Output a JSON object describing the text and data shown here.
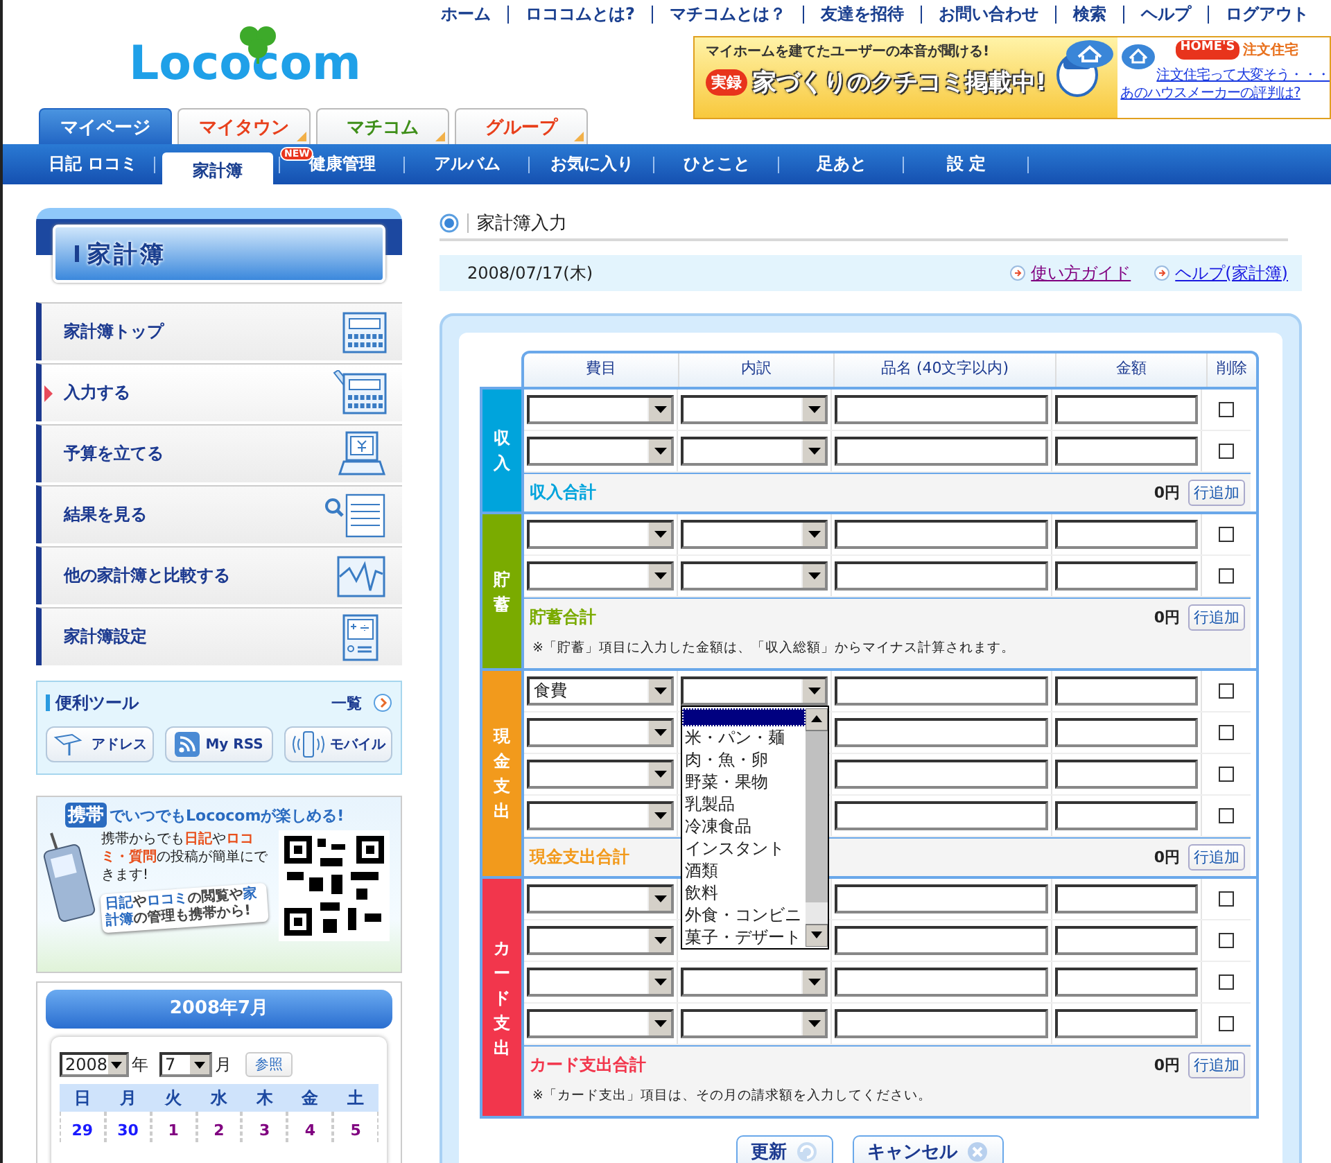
{
  "top_links": [
    "ホーム",
    "ロココムとは?",
    "マチコムとは？",
    "友達を招待",
    "お問い合わせ",
    "検索",
    "ヘルプ",
    "ログアウト"
  ],
  "logo": "Lococom",
  "ad_banner": {
    "tagline": "マイホームを建てたユーザーの本音が聞ける!",
    "badge": "実録",
    "headline": "家づくりのクチコミ掲載中!",
    "brand": "HOME'S",
    "brand_tag": "注文住宅",
    "links": [
      "注文住宅って大変そう・・・",
      "あのハウスメーカーの評判は?"
    ]
  },
  "main_tabs": [
    {
      "label": "マイページ",
      "selected": true
    },
    {
      "label": "マイタウン",
      "selected": false,
      "color": "#e8401c"
    },
    {
      "label": "マチコム",
      "selected": false,
      "color": "#3f8f1a"
    },
    {
      "label": "グループ",
      "selected": false,
      "color": "#e8401c"
    }
  ],
  "sub_nav": [
    {
      "label": "日記 ロコミ",
      "selected": false
    },
    {
      "label": "家計簿",
      "selected": true
    },
    {
      "label": "健康管理",
      "selected": false,
      "badge": "NEW"
    },
    {
      "label": "アルバム",
      "selected": false
    },
    {
      "label": "お気に入り",
      "selected": false
    },
    {
      "label": "ひとこと",
      "selected": false
    },
    {
      "label": "足あと",
      "selected": false
    },
    {
      "label": "設 定",
      "selected": false
    }
  ],
  "sidebar": {
    "title": "家計簿",
    "menu": [
      {
        "label": "家計簿トップ",
        "selected": false,
        "kind": "calculator"
      },
      {
        "label": "入力する",
        "selected": true,
        "kind": "calculator-pencil"
      },
      {
        "label": "予算を立てる",
        "selected": false,
        "kind": "monitor"
      },
      {
        "label": "結果を見る",
        "selected": false,
        "kind": "magnifier"
      },
      {
        "label": "他の家計簿と比較する",
        "selected": false,
        "kind": "chart"
      },
      {
        "label": "家計簿設定",
        "selected": false,
        "kind": "settings"
      }
    ],
    "tools": {
      "title": "便利ツール",
      "more": "一覧",
      "buttons": [
        {
          "label": "アドレス",
          "kind": "address"
        },
        {
          "label": "My RSS",
          "kind": "rss"
        },
        {
          "label": "モバイル",
          "kind": "mobile"
        }
      ]
    },
    "mobile_banner": {
      "badge": "携帯",
      "headline": "でいつでもLococomが楽しめる!",
      "body": "携帯からでも**日記**や**ロコミ・質問**の投稿が簡単にできます!",
      "callout": "**日記**や**ロコミ**の閲覧や**家計簿**の管理も携帯から!"
    },
    "calendar": {
      "title": "2008年7月",
      "year": "2008",
      "year_unit": "年",
      "month": "7",
      "month_unit": "月",
      "button": "参照",
      "weekdays": [
        "日",
        "月",
        "火",
        "水",
        "木",
        "金",
        "土"
      ],
      "days": [
        {
          "label": "29",
          "color": "#1a1aff"
        },
        {
          "label": "30",
          "color": "#1a1aff"
        },
        {
          "label": "1",
          "color": "#800080"
        },
        {
          "label": "2",
          "color": "#800080"
        },
        {
          "label": "3",
          "color": "#800080"
        },
        {
          "label": "4",
          "color": "#800080"
        },
        {
          "label": "5",
          "color": "#800080"
        }
      ]
    }
  },
  "main": {
    "title": "家計簿入力",
    "date": "2008/07/17(木)",
    "links": [
      {
        "label": "使い方ガイド",
        "visited": true
      },
      {
        "label": "ヘルプ(家計簿)",
        "visited": false
      }
    ],
    "columns": [
      "費目",
      "内訳",
      "品名 (40文字以内)",
      "金額",
      "削除"
    ],
    "sections": [
      {
        "label": "収入",
        "color": "#00a4dc",
        "total_label": "収入合計",
        "total": "0円",
        "add_button": "行追加",
        "rows": [
          {
            "delete": false
          },
          {
            "delete": false
          }
        ]
      },
      {
        "label": "貯蓄",
        "color": "#7aab00",
        "total_label": "貯蓄合計",
        "total": "0円",
        "add_button": "行追加",
        "note": "※「貯蓄」項目に入力した金額は、「収入総額」からマイナス計算されます。",
        "rows": [
          {
            "delete": false
          },
          {
            "delete": false
          }
        ]
      },
      {
        "label": "現金支出",
        "color": "#f29a1c",
        "total_label": "現金支出合計",
        "total": "0円",
        "add_button": "行追加",
        "rows": [
          {
            "category": "食費",
            "delete": false,
            "subcategory_options": [
              {
                "selected": true
              },
              {
                "label": "米・パン・麺",
                "selected": false
              },
              {
                "label": "肉・魚・卵",
                "selected": false
              },
              {
                "label": "野菜・果物",
                "selected": false
              },
              {
                "label": "乳製品",
                "selected": false
              },
              {
                "label": "冷凍食品",
                "selected": false
              },
              {
                "label": "インスタント",
                "selected": false
              },
              {
                "label": "酒類",
                "selected": false
              },
              {
                "label": "飲料",
                "selected": false
              },
              {
                "label": "外食・コンビニ",
                "selected": false
              },
              {
                "label": "菓子・デザート",
                "selected": false
              }
            ]
          },
          {
            "delete": false
          },
          {
            "delete": false
          },
          {
            "delete": false
          }
        ]
      },
      {
        "label": "カード支出",
        "color": "#f2364c",
        "total_label": "カード支出合計",
        "total": "0円",
        "add_button": "行追加",
        "note": "※「カード支出」項目は、その月の請求額を入力してください。",
        "rows": [
          {
            "delete": false
          },
          {
            "delete": false
          },
          {
            "delete": false
          },
          {
            "delete": false
          }
        ]
      }
    ],
    "buttons": [
      {
        "label": "更新",
        "kind": "update"
      },
      {
        "label": "キャンセル",
        "kind": "cancel"
      }
    ]
  }
}
